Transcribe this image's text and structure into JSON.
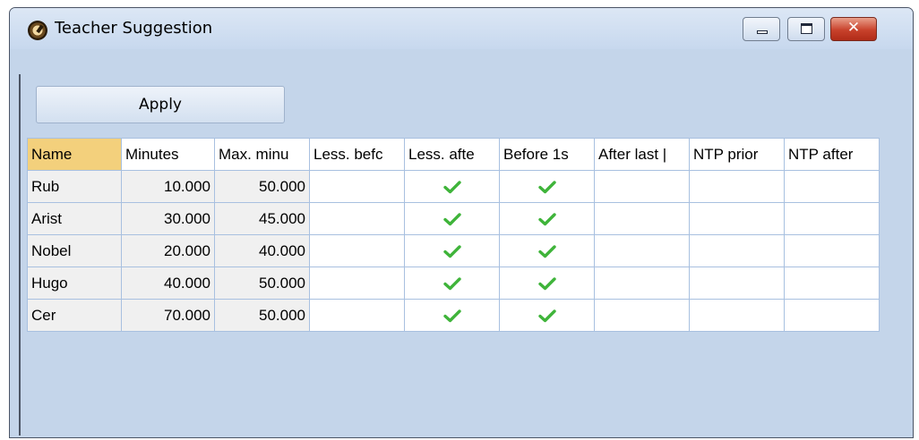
{
  "window": {
    "title": "Teacher Suggestion",
    "icon": "clock-icon"
  },
  "toolbar": {
    "apply_label": "Apply"
  },
  "grid": {
    "columns": [
      "Name",
      "Minutes",
      "Max. minu",
      "Less. befc",
      "Less. afte",
      "Before 1s",
      "After last |",
      "NTP prior",
      "NTP after"
    ],
    "rows": [
      {
        "name": "Rub",
        "minutes": "10.000",
        "max_minutes": "50.000",
        "less_before": false,
        "less_after": true,
        "before_first": true,
        "after_last": false,
        "ntp_prior": false,
        "ntp_after": false
      },
      {
        "name": "Arist",
        "minutes": "30.000",
        "max_minutes": "45.000",
        "less_before": false,
        "less_after": true,
        "before_first": true,
        "after_last": false,
        "ntp_prior": false,
        "ntp_after": false
      },
      {
        "name": "Nobel",
        "minutes": "20.000",
        "max_minutes": "40.000",
        "less_before": false,
        "less_after": true,
        "before_first": true,
        "after_last": false,
        "ntp_prior": false,
        "ntp_after": false
      },
      {
        "name": "Hugo",
        "minutes": "40.000",
        "max_minutes": "50.000",
        "less_before": false,
        "less_after": true,
        "before_first": true,
        "after_last": false,
        "ntp_prior": false,
        "ntp_after": false
      },
      {
        "name": "Cer",
        "minutes": "70.000",
        "max_minutes": "50.000",
        "less_before": false,
        "less_after": true,
        "before_first": true,
        "after_last": false,
        "ntp_prior": false,
        "ntp_after": false
      }
    ]
  },
  "colors": {
    "check": "#3fb43a",
    "selected_header": "#f3d07c",
    "close_button": "#c8412b"
  }
}
